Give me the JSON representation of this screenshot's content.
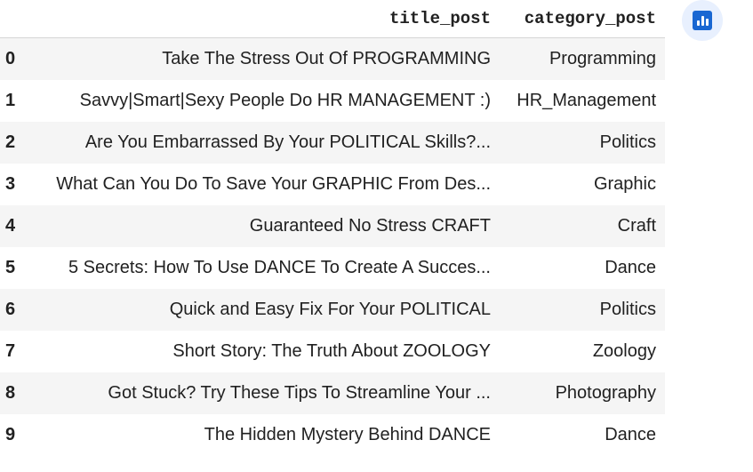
{
  "dataframe": {
    "columns": [
      "title_post",
      "category_post"
    ],
    "rows": [
      {
        "index": "0",
        "title_post": "Take The Stress Out Of PROGRAMMING",
        "category_post": "Programming"
      },
      {
        "index": "1",
        "title_post": "Savvy|Smart|Sexy People Do HR MANAGEMENT :)",
        "category_post": "HR_Management"
      },
      {
        "index": "2",
        "title_post": "Are You Embarrassed By Your POLITICAL Skills?...",
        "category_post": "Politics"
      },
      {
        "index": "3",
        "title_post": "What Can You Do To Save Your GRAPHIC From Des...",
        "category_post": "Graphic"
      },
      {
        "index": "4",
        "title_post": "Guaranteed No Stress CRAFT",
        "category_post": "Craft"
      },
      {
        "index": "5",
        "title_post": "5 Secrets: How To Use DANCE To Create A Succes...",
        "category_post": "Dance"
      },
      {
        "index": "6",
        "title_post": "Quick and Easy Fix For Your POLITICAL",
        "category_post": "Politics"
      },
      {
        "index": "7",
        "title_post": "Short Story: The Truth About ZOOLOGY",
        "category_post": "Zoology"
      },
      {
        "index": "8",
        "title_post": "Got Stuck? Try These Tips To Streamline Your ...",
        "category_post": "Photography"
      },
      {
        "index": "9",
        "title_post": "The Hidden Mystery Behind DANCE",
        "category_post": "Dance"
      }
    ]
  },
  "chart_button": {
    "icon": "bar-chart-icon",
    "accent_color": "#1967d2",
    "background_color": "#e8f0fe"
  }
}
